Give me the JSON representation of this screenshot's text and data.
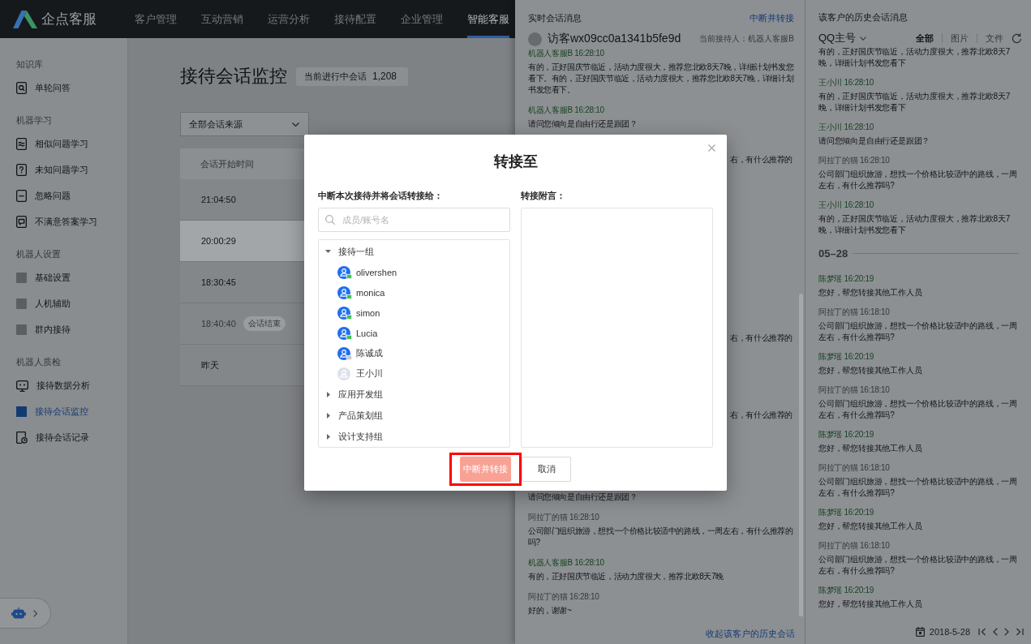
{
  "top_bar": {
    "logo": "企点客服",
    "nav": [
      {
        "label": "客户管理",
        "selected": false
      },
      {
        "label": "互动营销",
        "selected": false
      },
      {
        "label": "运营分析",
        "selected": false
      },
      {
        "label": "接待配置",
        "selected": false
      },
      {
        "label": "企业管理",
        "selected": false
      },
      {
        "label": "智能客服",
        "selected": true
      }
    ]
  },
  "sidebar": {
    "groups": [
      {
        "title": "知识库",
        "items": [
          {
            "label": "单轮问答",
            "selected": false
          }
        ]
      },
      {
        "title": "机器学习",
        "items": [
          {
            "label": "相似问题学习",
            "selected": false
          },
          {
            "label": "未知问题学习",
            "selected": false
          },
          {
            "label": "忽略问题",
            "selected": false
          },
          {
            "label": "不满意答案学习",
            "selected": false
          }
        ]
      },
      {
        "title": "机器人设置",
        "items": [
          {
            "label": "基础设置",
            "selected": false
          },
          {
            "label": "人机辅助",
            "selected": false
          },
          {
            "label": "群内接待",
            "selected": false
          }
        ]
      },
      {
        "title": "机器人质检",
        "items": [
          {
            "label": "接待数据分析",
            "selected": false
          },
          {
            "label": "接待会话监控",
            "selected": true
          },
          {
            "label": "接待会话记录",
            "selected": false
          }
        ]
      }
    ]
  },
  "page": {
    "title": "接待会话监控",
    "badge": {
      "label": "当前进行中会话",
      "count": "1,208"
    },
    "source_filter": {
      "value": "全部会话来源"
    },
    "table": {
      "columns": [
        "会话开始时间"
      ],
      "rows": [
        {
          "cells": [
            "21:04:50"
          ],
          "selected": false,
          "ended": false
        },
        {
          "cells": [
            "20:00:29"
          ],
          "selected": true,
          "ended": false
        },
        {
          "cells": [
            "18:30:45"
          ],
          "selected": false,
          "ended": false
        },
        {
          "cells": [
            "18:40:40"
          ],
          "selected": false,
          "ended": true,
          "tag": "会话结束"
        },
        {
          "cells": [
            "昨天"
          ],
          "selected": false,
          "ended": false
        }
      ]
    }
  },
  "live_chat": {
    "title": "实时会话消息",
    "action": "中断并转接",
    "visitor": {
      "name": "访客wx09cc0a1341b5fe9d",
      "agent": "当前接待人：机器人客服B"
    },
    "messages": [
      {
        "kind": "agent",
        "header": "机器人客服B 16:28:10",
        "text": "有的，正好国庆节临近，活动力度很大，推荐您北欧8天7晚，详细计划书发您看下。有的，正好国庆节临近，活动力度很大，推荐您北欧8天7晚，详细计划书发您看下。"
      },
      {
        "kind": "agent",
        "header": "机器人客服B 16:28:10",
        "text": "请问您倾向是自由行还是跟团？"
      },
      {
        "kind": "partial",
        "text": "右，有什么推荐的"
      },
      {
        "kind": "partial",
        "text": "右，有什么推荐的"
      },
      {
        "kind": "partial",
        "text": "右，有什么推荐的"
      },
      {
        "kind": "continued",
        "text": "请问您倾向是自由行还是跟团？"
      },
      {
        "kind": "visitor",
        "header": "阿拉丁的猫 16:28:10",
        "text": "公司部门组织旅游，想找一个价格比较适中的路线，一周左右，有什么推荐的吗?"
      },
      {
        "kind": "agent",
        "header": "机器人客服B 16:28:10",
        "text": "有的，正好国庆节临近，活动力度很大，推荐北欧8天7晚"
      },
      {
        "kind": "visitor",
        "header": "阿拉丁的猫 16:28:10",
        "text": "好的，谢谢~"
      }
    ],
    "collapse_link": "收起该客户的历史会话"
  },
  "history": {
    "title": "该客户的历史会话消息",
    "account": "QQ主号",
    "filters": [
      {
        "label": "全部",
        "selected": true
      },
      {
        "label": "图片",
        "selected": false
      },
      {
        "label": "文件",
        "selected": false
      }
    ],
    "messages": [
      {
        "kind": "continued",
        "text": "有的，正好国庆节临近，活动力度很大，推荐北欧8天7晚，详细计划书发您看下"
      },
      {
        "kind": "agent",
        "header": "王小川 16:28:10",
        "text": "有的，正好国庆节临近，活动力度很大，推荐北欧8天7晚，详细计划书发您看下"
      },
      {
        "kind": "agent",
        "header": "王小川 16:28:10",
        "text": "请问您倾向是自由行还是跟团？"
      },
      {
        "kind": "visitor",
        "header": "阿拉丁的猫 16:28:10",
        "text": "公司部门组织旅游，想找一个价格比较适中的路线，一周左右，有什么推荐吗?"
      },
      {
        "kind": "agent",
        "header": "王小川 16:28:10",
        "text": "有的，正好国庆节临近，活动力度很大，推荐北欧8天7晚，详细计划书发您看下"
      },
      {
        "kind": "divider",
        "label": "05–28"
      },
      {
        "kind": "agent",
        "header": "陈梦瑶 16:20:19",
        "text": "您好，帮您转接其他工作人员"
      },
      {
        "kind": "visitor",
        "header": "阿拉丁的猫 16:18:10",
        "text": "公司部门组织旅游，想找一个价格比较适中的路线，一周左右，有什么推荐吗?"
      },
      {
        "kind": "agent",
        "header": "陈梦瑶 16:20:19",
        "text": "您好，帮您转接其他工作人员"
      },
      {
        "kind": "visitor",
        "header": "阿拉丁的猫 16:18:10",
        "text": "公司部门组织旅游，想找一个价格比较适中的路线，一周左右，有什么推荐吗?"
      },
      {
        "kind": "agent",
        "header": "陈梦瑶 16:20:19",
        "text": "您好，帮您转接其他工作人员"
      },
      {
        "kind": "visitor",
        "header": "阿拉丁的猫 16:18:10",
        "text": "公司部门组织旅游，想找一个价格比较适中的路线，一周左右，有什么推荐吗?"
      },
      {
        "kind": "agent",
        "header": "陈梦瑶 16:20:19",
        "text": "您好，帮您转接其他工作人员"
      },
      {
        "kind": "visitor",
        "header": "阿拉丁的猫 16:18:10",
        "text": "公司部门组织旅游，想找一个价格比较适中的路线，一周左右，有什么推荐吗?"
      },
      {
        "kind": "agent",
        "header": "陈梦瑶 16:20:19",
        "text": "您好，帮您转接其他工作人员"
      }
    ],
    "date": "2018-5-28"
  },
  "modal": {
    "title": "转接至",
    "transfer_label": "中断本次接待并将会话转接给：",
    "search": {
      "placeholder": "成员/账号名"
    },
    "tree": [
      {
        "label": "接待一组",
        "expanded": true,
        "children": [
          {
            "label": "olivershen",
            "kind": "online"
          },
          {
            "label": "monica",
            "kind": "online"
          },
          {
            "label": "simon",
            "kind": "online"
          },
          {
            "label": "Lucia",
            "kind": "online"
          },
          {
            "label": "陈诚成",
            "kind": "busy"
          },
          {
            "label": "王小川",
            "kind": "offline"
          }
        ]
      },
      {
        "label": "应用开发组",
        "expanded": false
      },
      {
        "label": "产品策划组",
        "expanded": false
      },
      {
        "label": "设计支持组",
        "expanded": false
      }
    ],
    "note_label": "转接附言：",
    "buttons": [
      {
        "label": "中断并转接",
        "kind": "primary",
        "disabled": true,
        "highlighted": true
      },
      {
        "label": "取消",
        "kind": "default",
        "disabled": false,
        "highlighted": false
      }
    ]
  }
}
